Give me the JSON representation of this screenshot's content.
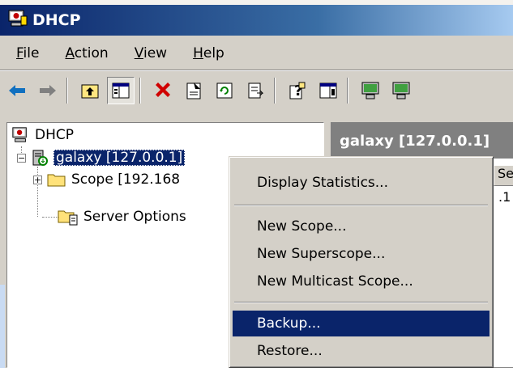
{
  "window": {
    "title": "DHCP"
  },
  "menu": [
    {
      "label": "File",
      "key": "F",
      "rest": "ile"
    },
    {
      "label": "Action",
      "key": "A",
      "rest": "ction"
    },
    {
      "label": "View",
      "key": "V",
      "rest": "iew"
    },
    {
      "label": "Help",
      "key": "H",
      "rest": "elp"
    }
  ],
  "toolbar": {
    "buttons": [
      "back-arrow-icon",
      "forward-arrow-icon",
      "up-folder-icon",
      "show-hide-tree-icon",
      "delete-icon",
      "properties-icon",
      "refresh-icon",
      "export-list-icon",
      "help-icon",
      "console-icon",
      "server-monitor-icon",
      "server-monitor-2-icon"
    ]
  },
  "tree": {
    "root": "DHCP",
    "server": "galaxy [127.0.0.1]",
    "scope": "Scope [192.168",
    "server_options": "Server Options"
  },
  "details": {
    "header": "galaxy [127.0.0.1]",
    "column": "Se",
    "cell": ".1"
  },
  "context_menu": {
    "display_statistics": "Display Statistics...",
    "new_scope": "New Scope...",
    "new_superscope": "New Superscope...",
    "new_multicast_scope": "New Multicast Scope...",
    "backup": "Backup...",
    "restore": "Restore..."
  },
  "colors": {
    "selection": "#0a246a",
    "face": "#d4d0c8"
  }
}
